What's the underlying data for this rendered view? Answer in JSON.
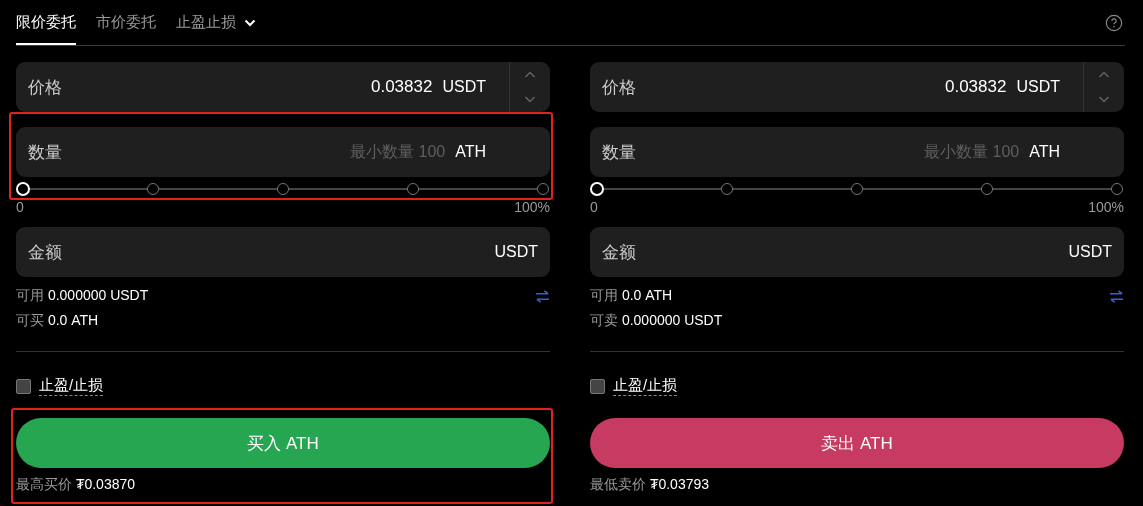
{
  "tabs": [
    {
      "label": "限价委托",
      "selected": true,
      "kind": "plain"
    },
    {
      "label": "市价委托",
      "selected": false,
      "kind": "plain"
    },
    {
      "label": "止盈止损",
      "selected": false,
      "kind": "dropdown"
    }
  ],
  "panels": [
    {
      "price": {
        "label": "价格",
        "value": "0.03832",
        "unit": "USDT"
      },
      "quantity": {
        "label": "数量",
        "placeholder": "最小数量 100",
        "unit": "ATH",
        "highlighted": true
      },
      "slider": {
        "level": 0,
        "min_label": "0",
        "max_label": "100%"
      },
      "amount": {
        "label": "金额",
        "unit": "USDT"
      },
      "info": [
        {
          "label": "可用",
          "value": "0.000000 USDT"
        },
        {
          "label": "可买",
          "value": "0.0 ATH"
        }
      ],
      "tpsl": {
        "label": "止盈/止损",
        "checked": false
      },
      "action": {
        "kind": "buy",
        "label": "买入 ATH",
        "highlighted": true
      },
      "best_price": {
        "label": "最高买价",
        "value": "₮0.03870"
      }
    },
    {
      "price": {
        "label": "价格",
        "value": "0.03832",
        "unit": "USDT"
      },
      "quantity": {
        "label": "数量",
        "placeholder": "最小数量 100",
        "unit": "ATH",
        "highlighted": false
      },
      "slider": {
        "level": 0,
        "min_label": "0",
        "max_label": "100%"
      },
      "amount": {
        "label": "金额",
        "unit": "USDT"
      },
      "info": [
        {
          "label": "可用",
          "value": "0.0 ATH"
        },
        {
          "label": "可卖",
          "value": "0.000000 USDT"
        }
      ],
      "tpsl": {
        "label": "止盈/止损",
        "checked": false
      },
      "action": {
        "kind": "sell",
        "label": "卖出 ATH",
        "highlighted": false
      },
      "best_price": {
        "label": "最低卖价",
        "value": "₮0.03793"
      }
    }
  ]
}
